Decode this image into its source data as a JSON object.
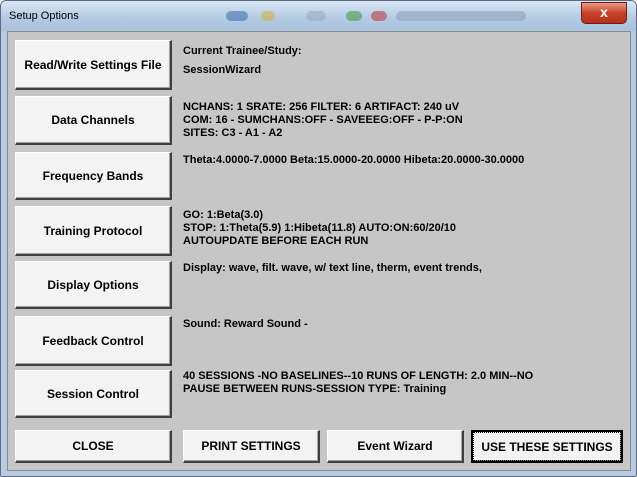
{
  "window": {
    "title": "Setup Options",
    "close_glyph": "x"
  },
  "buttons": {
    "read_write": "Read/Write Settings File",
    "data_channels": "Data Channels",
    "frequency_bands": "Frequency Bands",
    "training_protocol": "Training Protocol",
    "display_options": "Display Options",
    "feedback_control": "Feedback Control",
    "session_control": "Session Control"
  },
  "info": {
    "trainee_label": "Current Trainee/Study:",
    "trainee_value": "SessionWizard",
    "channels_line1": "NCHANS: 1   SRATE: 256   FILTER: 6  ARTIFACT: 240 uV",
    "channels_line2": "COM: 16 - SUMCHANS:OFF - SAVEEEG:OFF - P-P:ON",
    "channels_line3": "SITES:  C3 - A1 - A2",
    "bands_line1": "Theta:4.0000-7.0000 Beta:15.0000-20.0000 Hibeta:20.0000-30.0000",
    "protocol_line1": "GO:  1:Beta(3.0)",
    "protocol_line2": "STOP: 1:Theta(5.9) 1:Hibeta(11.8) AUTO:ON:60/20/10",
    "protocol_line3": "AUTOUPDATE BEFORE EACH RUN",
    "display_line1": "Display: wave, filt. wave, w/ text line, therm, event trends,",
    "feedback_line1": "Sound: Reward Sound -",
    "session_line1": "40 SESSIONS -NO BASELINES--10 RUNS OF LENGTH: 2.0 MIN--NO",
    "session_line2": "PAUSE BETWEEN RUNS-SESSION TYPE: Training"
  },
  "footer": {
    "close": "CLOSE",
    "print": "PRINT SETTINGS",
    "event_wizard": "Event Wizard",
    "use": "USE THESE SETTINGS"
  }
}
